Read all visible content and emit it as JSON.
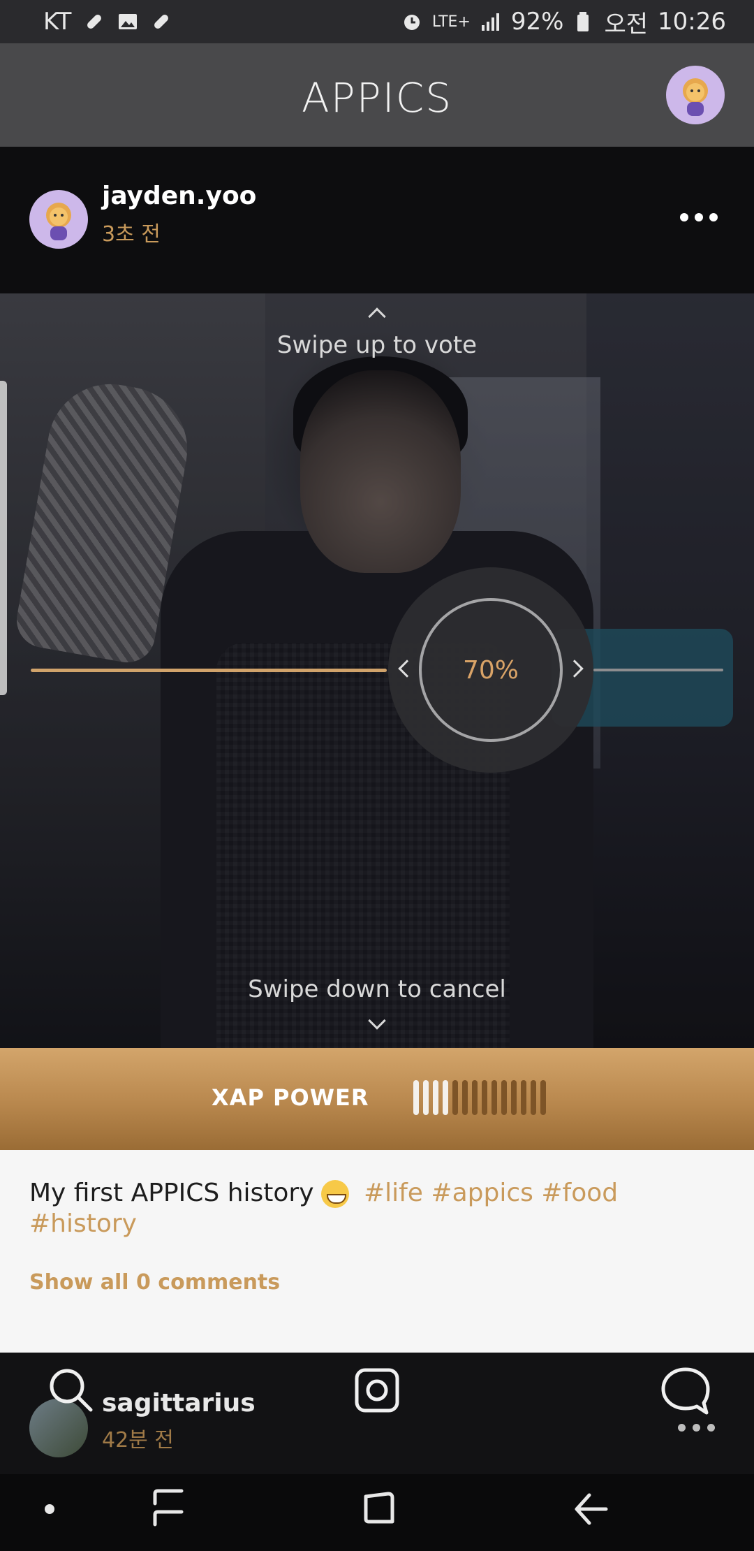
{
  "status_bar": {
    "carrier": "KT",
    "network": "LTE+",
    "battery": "92%",
    "ampm": "오전",
    "time": "10:26",
    "icons": [
      "bandage-icon",
      "image-icon",
      "bandage-icon",
      "alarm-icon",
      "signal-icon",
      "battery-icon"
    ]
  },
  "app_bar": {
    "logo": "APPICS",
    "profile_icon": "avatar-lion-icon"
  },
  "post": {
    "username": "jayden.yoo",
    "time_ago": "3초 전",
    "more_icon": "more-horizontal-icon",
    "swipe_up_text": "Swipe up to vote",
    "swipe_down_text": "Swipe down to cancel",
    "vote_percent": "70%",
    "vote_level": 0.7
  },
  "xap": {
    "label": "XAP POWER",
    "segments_total": 14,
    "segments_on": 4
  },
  "caption": {
    "text": "My first APPICS history",
    "emoji_icon": "grinning-face-icon",
    "tags": [
      "#life",
      "#appics",
      "#food",
      "#history"
    ],
    "show_comments": "Show all 0 comments"
  },
  "bottom_nav": {
    "next_username": "sagittarius",
    "next_time_ago": "42분 전",
    "icons": [
      "search-icon",
      "camera-icon",
      "chat-bubble-icon",
      "more-horizontal-icon"
    ]
  },
  "colors": {
    "accent": "#c99a5b",
    "topbar": "#49494b",
    "xap_gradient_top": "#d3a56b",
    "xap_gradient_bottom": "#9a6c35"
  }
}
